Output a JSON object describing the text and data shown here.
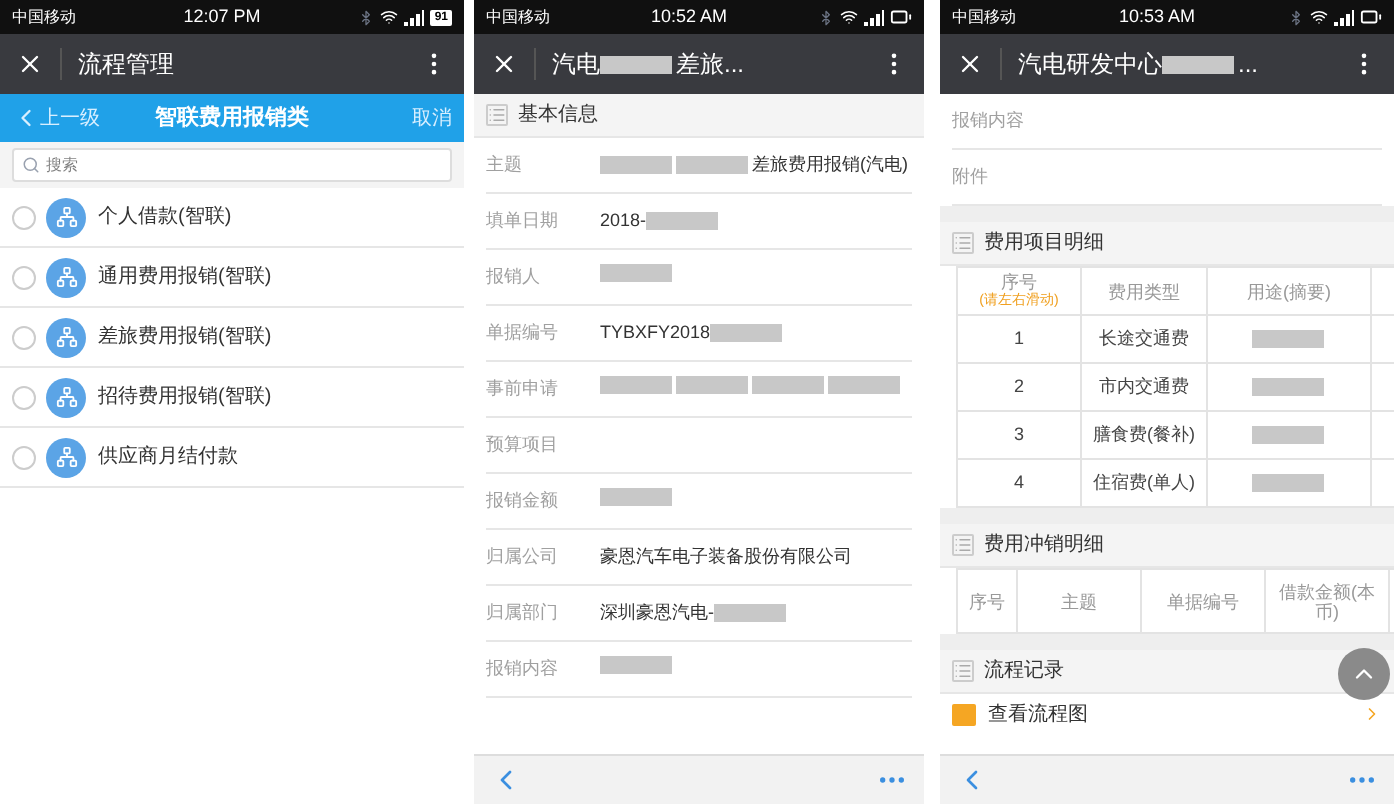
{
  "screens": [
    {
      "kind": "picker",
      "status": {
        "carrier": "中国移动",
        "time": "12:07 PM",
        "battery": "91"
      },
      "title": [
        {
          "kind": "text",
          "text": "流程管理"
        }
      ],
      "nav": {
        "back": "上一级",
        "title": "智联费用报销类",
        "cancel": "取消"
      },
      "search": {
        "placeholder": "搜索"
      },
      "items": [
        {
          "label": "个人借款(智联)",
          "selected": false
        },
        {
          "label": "通用费用报销(智联)",
          "selected": false
        },
        {
          "label": "差旅费用报销(智联)",
          "selected": false
        },
        {
          "label": "招待费用报销(智联)",
          "selected": false
        },
        {
          "label": "供应商月结付款",
          "selected": false
        }
      ]
    },
    {
      "kind": "form",
      "status": {
        "carrier": "中国移动",
        "time": "10:52 AM"
      },
      "title": [
        {
          "kind": "text",
          "text": "汽电"
        },
        {
          "kind": "redacted"
        },
        {
          "kind": "text",
          "text": "差旅..."
        }
      ],
      "blocks": [
        {
          "kind": "section",
          "title": "基本信息"
        },
        {
          "kind": "field",
          "label": "主题",
          "value": [
            {
              "kind": "redacted"
            },
            {
              "kind": "redacted"
            },
            {
              "kind": "text",
              "text": "差旅费用报销(汽电)"
            }
          ]
        },
        {
          "kind": "field",
          "label": "填单日期",
          "value": [
            {
              "kind": "text",
              "text": "2018-"
            },
            {
              "kind": "redacted"
            }
          ]
        },
        {
          "kind": "field",
          "label": "报销人",
          "value": [
            {
              "kind": "redacted"
            }
          ]
        },
        {
          "kind": "field",
          "label": "单据编号",
          "value": [
            {
              "kind": "text",
              "text": "TYBXFY2018"
            },
            {
              "kind": "redacted"
            }
          ]
        },
        {
          "kind": "field",
          "label": "事前申请",
          "value": [
            {
              "kind": "redacted"
            },
            {
              "kind": "redacted"
            },
            {
              "kind": "redacted"
            },
            {
              "kind": "redacted"
            }
          ]
        },
        {
          "kind": "field",
          "label": "预算项目"
        },
        {
          "kind": "field",
          "label": "报销金额",
          "value": [
            {
              "kind": "redacted"
            }
          ]
        },
        {
          "kind": "field",
          "label": "归属公司",
          "value": [
            {
              "kind": "text",
              "text": "豪恩汽车电子装备股份有限公司"
            }
          ]
        },
        {
          "kind": "field",
          "label": "归属部门",
          "value": [
            {
              "kind": "text",
              "text": "深圳豪恩汽电-"
            },
            {
              "kind": "redacted"
            }
          ]
        },
        {
          "kind": "field",
          "label": "报销内容",
          "value": [
            {
              "kind": "redacted"
            }
          ]
        }
      ]
    },
    {
      "kind": "form",
      "status": {
        "carrier": "中国移动",
        "time": "10:53 AM"
      },
      "title": [
        {
          "kind": "text",
          "text": "汽电研发中心"
        },
        {
          "kind": "redacted"
        },
        {
          "kind": "text",
          "text": "..."
        }
      ],
      "blocks": [
        {
          "kind": "field",
          "label": "报销内容"
        },
        {
          "kind": "field",
          "label": "附件"
        },
        {
          "kind": "gap"
        },
        {
          "kind": "section",
          "title": "费用项目明细"
        },
        {
          "kind": "table",
          "hint": "(请左右滑动)",
          "columns": [
            "序号",
            "费用类型",
            "用途(摘要)"
          ],
          "rows": [
            [
              "1",
              "长途交通费",
              {
                "kind": "redacted"
              }
            ],
            [
              "2",
              "市内交通费",
              {
                "kind": "redacted"
              }
            ],
            [
              "3",
              "膳食费(餐补)",
              {
                "kind": "redacted"
              }
            ],
            [
              "4",
              "住宿费(单人)",
              {
                "kind": "redacted"
              }
            ]
          ]
        },
        {
          "kind": "gap"
        },
        {
          "kind": "section",
          "title": "费用冲销明细"
        },
        {
          "kind": "table",
          "columns": [
            "序号",
            "主题",
            "单据编号",
            "借款金额(本币)"
          ]
        },
        {
          "kind": "gap"
        },
        {
          "kind": "section",
          "title": "流程记录"
        },
        {
          "kind": "link",
          "label": "查看流程图"
        }
      ]
    }
  ]
}
